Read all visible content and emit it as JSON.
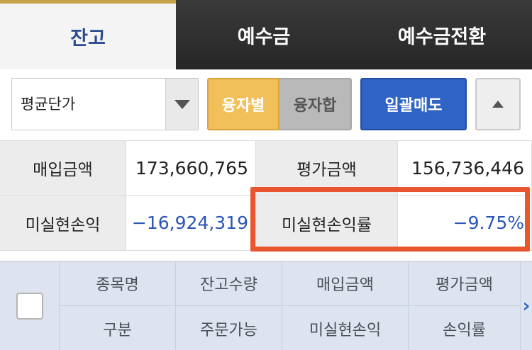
{
  "tabs": [
    {
      "label": "잔고"
    },
    {
      "label": "예수금"
    },
    {
      "label": "예수금전환"
    }
  ],
  "controls": {
    "select_value": "평균단가",
    "btn_yung": "융자별",
    "btn_hap": "융자합",
    "btn_sell": "일괄매도"
  },
  "summary": {
    "buy_amount_label": "매입금액",
    "buy_amount_value": "173,660,765",
    "eval_amount_label": "평가금액",
    "eval_amount_value": "156,736,446",
    "unrealized_pl_label": "미실현손익",
    "unrealized_pl_value": "−16,924,319",
    "unrealized_rate_label": "미실현손익률",
    "unrealized_rate_value": "−9.75%"
  },
  "columns": {
    "row1": [
      "종목명",
      "잔고수량",
      "매입금액",
      "평가금액"
    ],
    "row2": [
      "구분",
      "주문가능",
      "미실현손익",
      "손익률"
    ]
  },
  "colors": {
    "accent_gold": "#f1c05a",
    "accent_blue": "#2f63c4",
    "negative_blue": "#2b55b8",
    "highlight_red": "#e8552f"
  }
}
